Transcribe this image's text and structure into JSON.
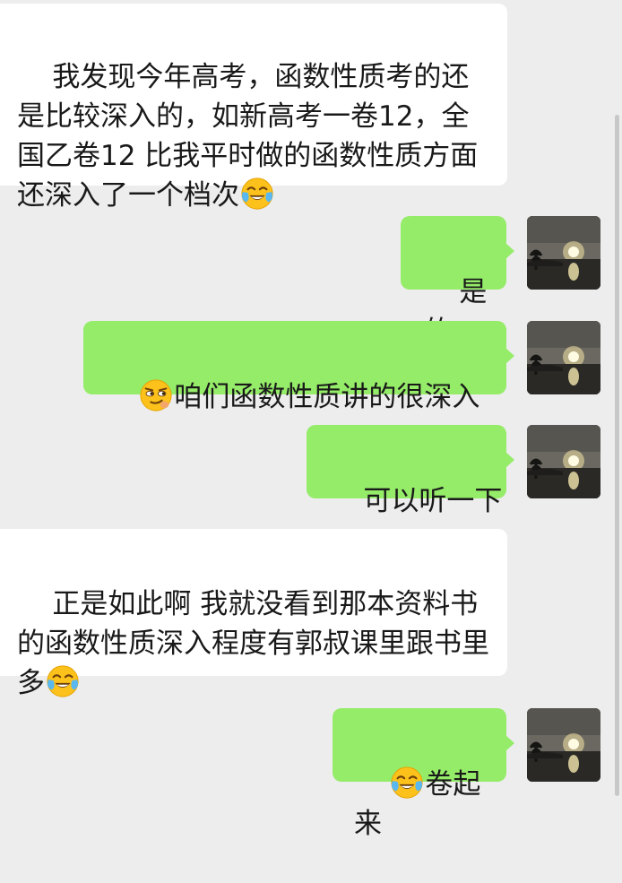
{
  "conversation": {
    "messages": [
      {
        "side": "received",
        "text": "我发现今年高考，函数性质考的还是比较深入的，如新高考一卷12，全国乙卷12 比我平时做的函数性质方面还深入了一个档次",
        "emoji_before": null,
        "emoji_after": "crying-laughing-emoji"
      },
      {
        "side": "sent",
        "text": "是的",
        "emoji_before": null,
        "emoji_after": null
      },
      {
        "side": "sent",
        "text": "咱们函数性质讲的很深入",
        "emoji_before": "smirk-emoji",
        "emoji_after": null
      },
      {
        "side": "sent",
        "text": "可以听一下",
        "emoji_before": null,
        "emoji_after": null
      },
      {
        "side": "received",
        "text": "正是如此啊 我就没看到那本资料书的函数性质深入程度有郭叔课里跟书里多",
        "emoji_before": null,
        "emoji_after": "crying-laughing-emoji"
      },
      {
        "side": "sent",
        "text": "卷起来",
        "emoji_before": "crying-laughing-emoji",
        "emoji_after": null
      }
    ]
  },
  "colors": {
    "background": "#ededed",
    "received_bubble": "#ffffff",
    "sent_bubble": "#95ec69",
    "text": "#191919"
  }
}
